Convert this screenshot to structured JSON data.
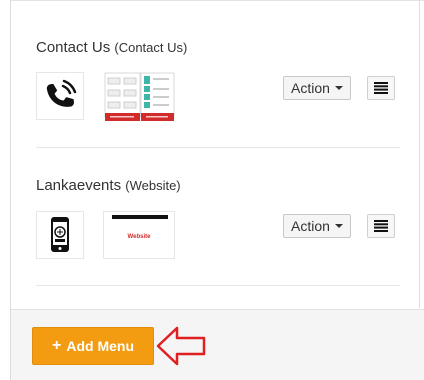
{
  "menus": [
    {
      "name": "Contact Us",
      "type": "(Contact Us)",
      "action_label": "Action",
      "template_label_left": "",
      "template_label_right": ""
    },
    {
      "name": "Lankaevents",
      "type": "(Website)",
      "action_label": "Action",
      "template_label": "Website"
    }
  ],
  "footer": {
    "add_menu_label": "Add Menu"
  },
  "colors": {
    "accent": "#f39c12",
    "annotation_arrow": "#e02020",
    "template_red": "#d22b2b",
    "template_teal": "#3fb7a8"
  },
  "icons": {
    "contact": "phone-icon",
    "website": "mobile-phone-icon",
    "list": "list-icon",
    "add": "plus-icon"
  }
}
